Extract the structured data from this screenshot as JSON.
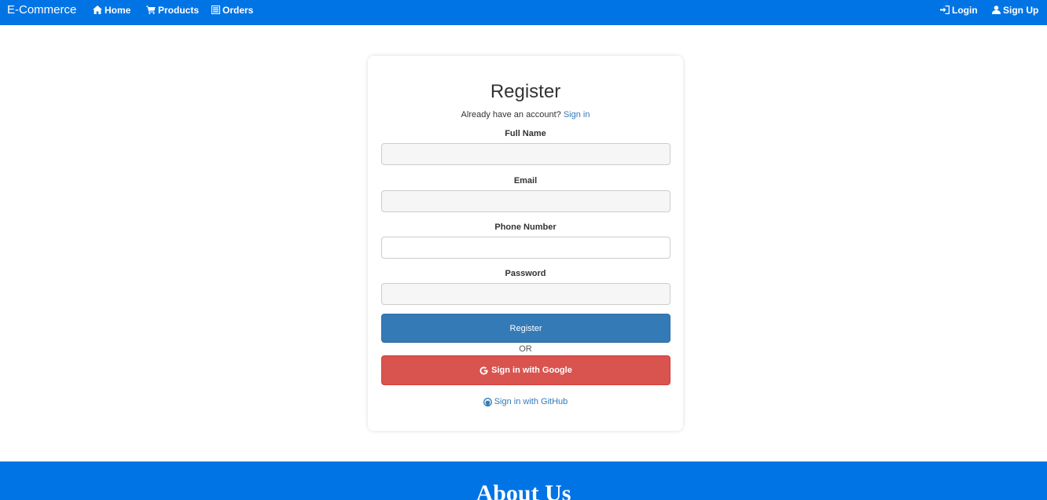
{
  "navbar": {
    "brand": "E-Commerce",
    "color": "#0174e5",
    "left_items": [
      {
        "label": "Home",
        "icon": "home-icon"
      },
      {
        "label": "Products",
        "icon": "cart-icon"
      },
      {
        "label": "Orders",
        "icon": "list-icon"
      }
    ],
    "right_items": [
      {
        "label": "Login",
        "icon": "login-icon"
      },
      {
        "label": "Sign Up",
        "icon": "user-icon"
      }
    ]
  },
  "register": {
    "title": "Register",
    "subtitle_prefix": "Already have an account?",
    "signin_link": "Sign in",
    "fields": [
      {
        "label": "Full Name",
        "value": "",
        "placeholder": ""
      },
      {
        "label": "Email",
        "value": "",
        "placeholder": ""
      },
      {
        "label": "Phone Number",
        "value": "",
        "placeholder": ""
      },
      {
        "label": "Password",
        "value": "",
        "placeholder": ""
      }
    ],
    "register_button": "Register",
    "or_text": "OR",
    "google_button": "Sign in with Google",
    "github_link": "Sign in with GitHub"
  },
  "colors": {
    "primary_button": "#337ab7",
    "google_button": "#d9534f",
    "link": "#337ab7"
  },
  "about": {
    "title": "About Us"
  }
}
